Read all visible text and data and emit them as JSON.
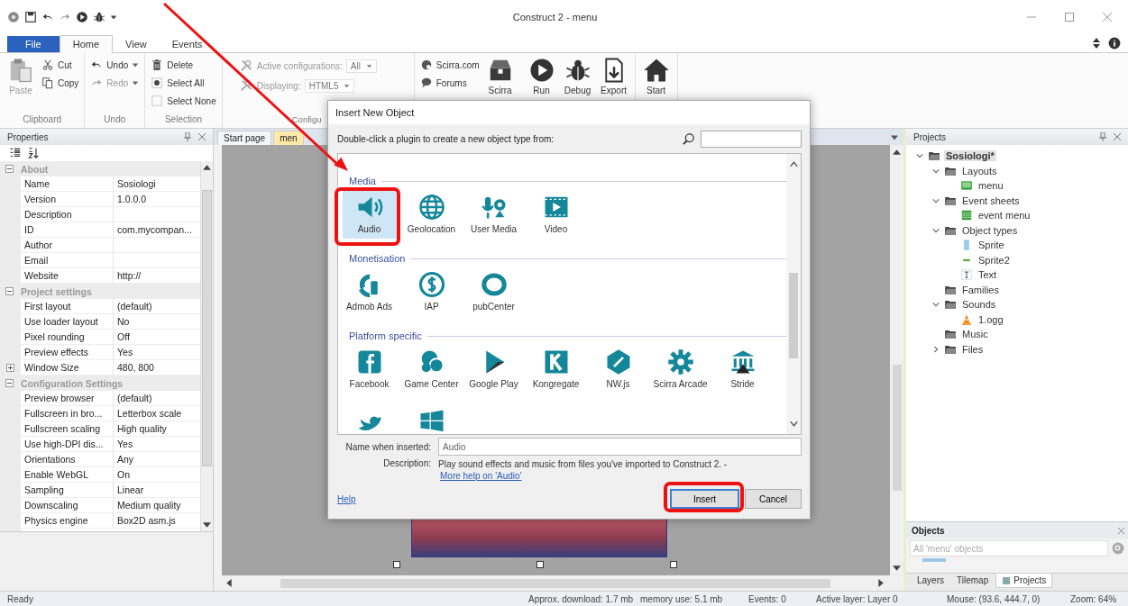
{
  "window": {
    "title": "Construct 2 - menu"
  },
  "ribbon_tabs": [
    {
      "label": "File",
      "kind": "file",
      "selected": false
    },
    {
      "label": "Home",
      "kind": "tab",
      "selected": true
    },
    {
      "label": "View",
      "kind": "tab",
      "selected": false
    },
    {
      "label": "Events",
      "kind": "tab",
      "selected": false
    }
  ],
  "ribbon_groups": [
    {
      "label": "Clipboard",
      "columns": [
        [
          {
            "kind": "large",
            "label": "Paste",
            "disabled": true
          }
        ],
        [
          {
            "kind": "small",
            "label": "Cut",
            "disabled": false
          },
          {
            "kind": "small",
            "label": "Copy",
            "disabled": false
          }
        ]
      ]
    },
    {
      "label": "Undo",
      "columns": [
        [
          {
            "kind": "small",
            "label": "Undo",
            "disabled": false,
            "menu": true
          },
          {
            "kind": "small",
            "label": "Redo",
            "disabled": true,
            "menu": true
          }
        ]
      ]
    },
    {
      "label": "Selection",
      "columns": [
        [
          {
            "kind": "small",
            "label": "Delete",
            "disabled": false
          },
          {
            "kind": "small",
            "label": "Select All",
            "disabled": false
          },
          {
            "kind": "small",
            "label": "Select None",
            "disabled": false
          }
        ]
      ]
    },
    {
      "label": "Configu",
      "columns": [
        [
          {
            "kind": "dropdown",
            "label": "Active configurations:",
            "value": "All",
            "disabled": true
          },
          {
            "kind": "dropdown",
            "label": "Displaying:",
            "value": "HTML5",
            "disabled": true
          }
        ]
      ]
    },
    {
      "columns": [
        [
          {
            "kind": "small",
            "label": "Scirra.com",
            "disabled": false
          },
          {
            "kind": "small",
            "label": "Forums",
            "disabled": false
          }
        ],
        [
          {
            "kind": "large",
            "label": "Scirra",
            "disabled": false
          }
        ]
      ]
    },
    {
      "columns": [
        [
          {
            "kind": "large",
            "label": "Run",
            "disabled": false
          }
        ],
        [
          {
            "kind": "large",
            "label": "Debug",
            "disabled": false
          }
        ],
        [
          {
            "kind": "large",
            "label": "Export",
            "disabled": false
          }
        ]
      ]
    },
    {
      "columns": [
        [
          {
            "kind": "large",
            "label": "Start",
            "disabled": false
          }
        ]
      ]
    }
  ],
  "properties": {
    "title": "Properties",
    "rows": [
      {
        "kind": "section",
        "label": "About",
        "expanded": true
      },
      {
        "kind": "row",
        "name": "Name",
        "value": "Sosiologi"
      },
      {
        "kind": "row",
        "name": "Version",
        "value": "1.0.0.0"
      },
      {
        "kind": "row",
        "name": "Description"
      },
      {
        "kind": "row",
        "name": "ID",
        "value": "com.mycompan..."
      },
      {
        "kind": "row",
        "name": "Author"
      },
      {
        "kind": "row",
        "name": "Email"
      },
      {
        "kind": "row",
        "name": "Website",
        "value": "http://"
      },
      {
        "kind": "section",
        "label": "Project settings",
        "expanded": true
      },
      {
        "kind": "row",
        "name": "First layout",
        "value": "(default)"
      },
      {
        "kind": "row",
        "name": "Use loader layout",
        "value": "No"
      },
      {
        "kind": "row",
        "name": "Pixel rounding",
        "value": "Off"
      },
      {
        "kind": "row",
        "name": "Preview effects",
        "value": "Yes"
      },
      {
        "kind": "group_row",
        "name": "Window Size",
        "value": "480, 800",
        "expanded": false
      },
      {
        "kind": "section",
        "label": "Configuration Settings",
        "expanded": true
      },
      {
        "kind": "row",
        "name": "Preview browser",
        "value": "(default)"
      },
      {
        "kind": "row",
        "name": "Fullscreen in bro...",
        "value": "Letterbox scale"
      },
      {
        "kind": "row",
        "name": "Fullscreen scaling",
        "value": "High quality"
      },
      {
        "kind": "row",
        "name": "Use high-DPI dis...",
        "value": "Yes"
      },
      {
        "kind": "row",
        "name": "Orientations",
        "value": "Any"
      },
      {
        "kind": "row",
        "name": "Enable WebGL",
        "value": "On"
      },
      {
        "kind": "row",
        "name": "Sampling",
        "value": "Linear"
      },
      {
        "kind": "row",
        "name": "Downscaling",
        "value": "Medium quality"
      },
      {
        "kind": "row",
        "name": "Physics engine",
        "value": "Box2D asm.js"
      }
    ]
  },
  "editor": {
    "tabs": [
      {
        "label": "Start page",
        "selected": false
      },
      {
        "label": "men",
        "selected": true
      }
    ]
  },
  "dialog": {
    "title": "Insert New Object",
    "instruction": "Double-click a plugin to create a new object type from:",
    "categories": [
      {
        "label": "Media",
        "items": [
          {
            "label": "Audio",
            "selected": true
          },
          {
            "label": "Geolocation",
            "selected": false
          },
          {
            "label": "User Media",
            "selected": false
          },
          {
            "label": "Video",
            "selected": false
          }
        ]
      },
      {
        "label": "Monetisation",
        "items": [
          {
            "label": "Admob Ads",
            "selected": false
          },
          {
            "label": "IAP",
            "selected": false
          },
          {
            "label": "pubCenter",
            "selected": false
          }
        ]
      },
      {
        "label": "Platform specific",
        "items": [
          {
            "label": "Facebook",
            "selected": false
          },
          {
            "label": "Game Center",
            "selected": false
          },
          {
            "label": "Google Play",
            "selected": false
          },
          {
            "label": "Kongregate",
            "selected": false
          },
          {
            "label": "NW.js",
            "selected": false
          },
          {
            "label": "Scirra Arcade",
            "selected": false
          },
          {
            "label": "Stride",
            "selected": false
          },
          {
            "selected": false
          },
          {
            "selected": false
          }
        ]
      }
    ],
    "name_label": "Name when inserted:",
    "name_value": "Audio",
    "description_label": "Description:",
    "description": "Play sound effects and music from files you've imported to Construct 2. -",
    "description_link": "More help on 'Audio'",
    "help": "Help",
    "buttons": [
      {
        "label": "Insert",
        "kind": "default"
      },
      {
        "label": "Cancel",
        "kind": "normal"
      }
    ]
  },
  "projects": {
    "title": "Projects",
    "tree": [
      {
        "label": "Sosiologi*",
        "expanded": true,
        "selected": true,
        "children": [
          {
            "label": "Layouts",
            "expanded": true,
            "selected": false,
            "children": [
              {
                "label": "menu",
                "selected": false
              }
            ]
          },
          {
            "label": "Event sheets",
            "expanded": true,
            "selected": false,
            "children": [
              {
                "label": "event menu",
                "selected": false
              }
            ]
          },
          {
            "label": "Object types",
            "expanded": true,
            "selected": false,
            "children": [
              {
                "label": "Sprite",
                "selected": false
              },
              {
                "label": "Sprite2",
                "selected": false
              },
              {
                "label": "Text",
                "selected": false
              }
            ]
          },
          {
            "label": "Families",
            "selected": false
          },
          {
            "label": "Sounds",
            "expanded": true,
            "selected": false,
            "children": [
              {
                "label": "1.ogg",
                "selected": false
              }
            ]
          },
          {
            "label": "Music",
            "selected": false
          },
          {
            "label": "Files",
            "expanded": false,
            "selected": false
          }
        ]
      }
    ]
  },
  "objects": {
    "title": "Objects",
    "placeholder": "All 'menu' objects"
  },
  "bottom_tabs": [
    {
      "label": "Layers",
      "selected": false
    },
    {
      "label": "Tilemap",
      "selected": false
    },
    {
      "label": "Projects",
      "selected": true
    }
  ],
  "status_bar": [
    "Ready",
    "Approx. download: 1.7 mb",
    "memory use: 5.1 mb",
    "Events: 0",
    "Active layer: Layer 0",
    "Mouse: (93.6, 444.7, 0)",
    "Zoom: 64%"
  ]
}
